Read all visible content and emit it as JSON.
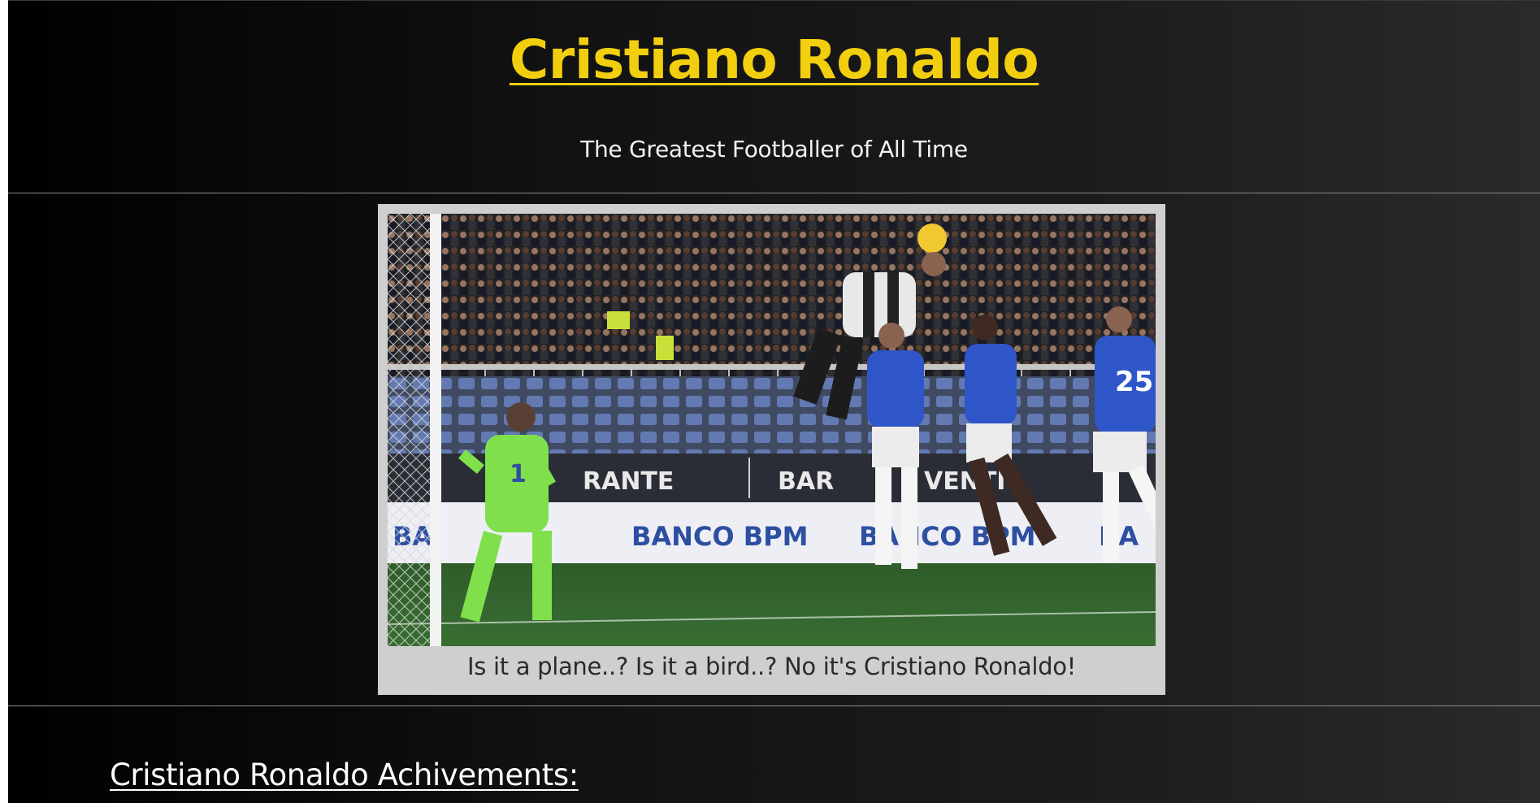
{
  "header": {
    "title": "Cristiano Ronaldo",
    "tagline": "The Greatest Footballer of All Time"
  },
  "figure": {
    "caption": "Is it a plane..? Is it a bird..? No it's Cristiano Ronaldo!",
    "ad_text": {
      "left_partial": "BA",
      "banco_1": "BANCO BPM",
      "banco_2": "BANCO BPM",
      "right_partial": "BA",
      "upper_1": "RANTE",
      "upper_2": "BAR",
      "upper_3": "VENTI"
    },
    "jersey_numbers": {
      "keeper": "1",
      "defender": "25"
    }
  },
  "sections": {
    "achievements_heading": "Cristiano Ronaldo Achivements:"
  },
  "colors": {
    "title": "#f2cf0e",
    "tagline": "#f2f2f2",
    "frame": "#cfcfcf",
    "page_dark": "#000000",
    "page_light": "#2a2a2a"
  }
}
